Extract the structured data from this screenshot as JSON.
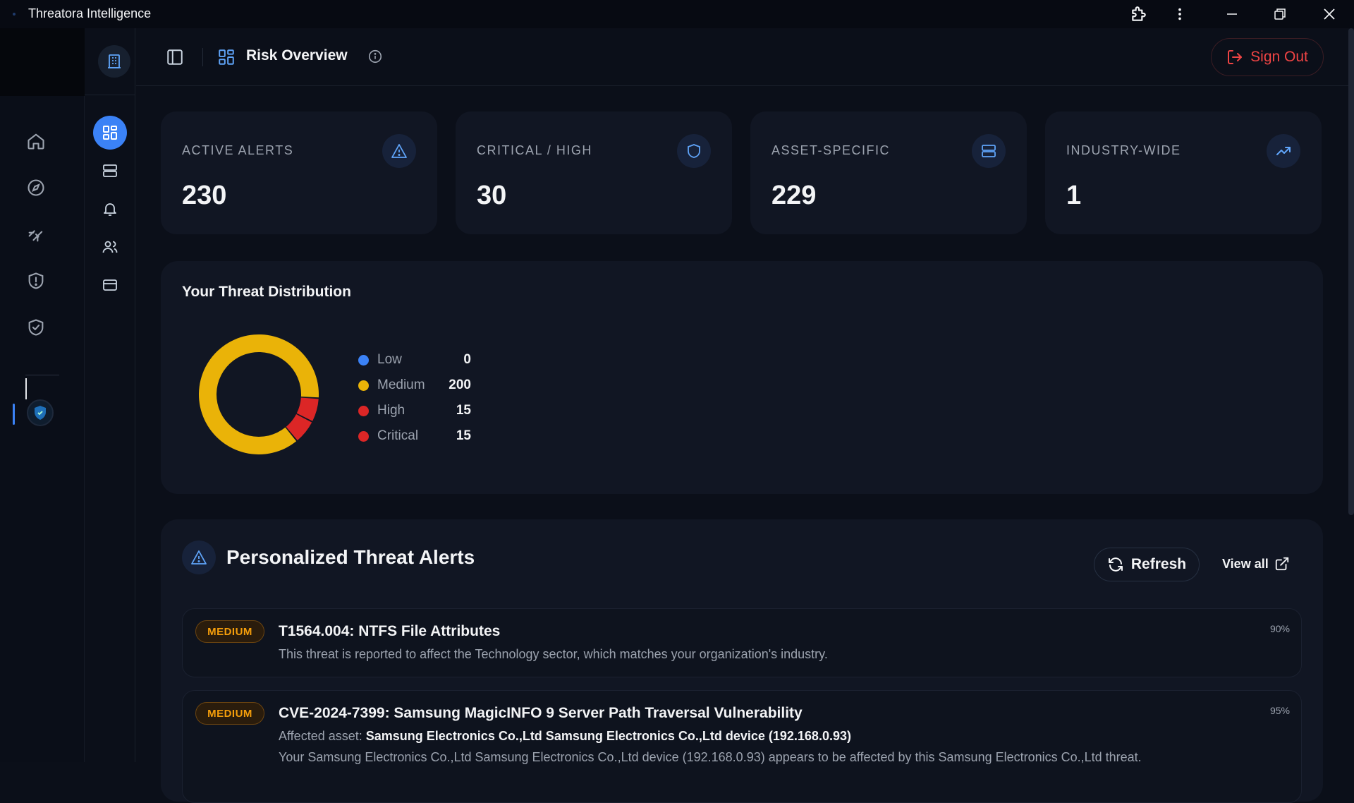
{
  "window": {
    "title": "Threatora Intelligence"
  },
  "header": {
    "title": "Risk Overview",
    "sign_out": "Sign Out"
  },
  "stats": [
    {
      "label": "ACTIVE ALERTS",
      "value": "230",
      "icon": "alert-triangle-icon"
    },
    {
      "label": "CRITICAL / HIGH",
      "value": "30",
      "icon": "shield-icon"
    },
    {
      "label": "ASSET-SPECIFIC",
      "value": "229",
      "icon": "server-icon"
    },
    {
      "label": "INDUSTRY-WIDE",
      "value": "1",
      "icon": "trending-up-icon"
    }
  ],
  "distribution": {
    "title": "Your Threat Distribution",
    "legend": [
      {
        "name": "Low",
        "value": "0",
        "color": "#3b82f6"
      },
      {
        "name": "Medium",
        "value": "200",
        "color": "#eab308"
      },
      {
        "name": "High",
        "value": "15",
        "color": "#dc2626"
      },
      {
        "name": "Critical",
        "value": "15",
        "color": "#dc2626"
      }
    ]
  },
  "alerts": {
    "title": "Personalized Threat Alerts",
    "refresh": "Refresh",
    "view_all": "View all",
    "items": [
      {
        "severity": "MEDIUM",
        "title": "T1564.004: NTFS File Attributes",
        "description": "This threat is reported to affect the Technology sector, which matches your organization's industry.",
        "confidence": "90%"
      },
      {
        "severity": "MEDIUM",
        "title": "CVE-2024-7399: Samsung MagicINFO 9 Server Path Traversal Vulnerability",
        "affected_label": "Affected asset:",
        "affected_value": "Samsung Electronics Co.,Ltd Samsung Electronics Co.,Ltd device (192.168.0.93)",
        "description": "Your Samsung Electronics Co.,Ltd Samsung Electronics Co.,Ltd device (192.168.0.93) appears to be affected by this Samsung Electronics Co.,Ltd threat.",
        "confidence": "95%"
      }
    ]
  },
  "chart_data": {
    "type": "pie",
    "categories": [
      "Low",
      "Medium",
      "High",
      "Critical"
    ],
    "values": [
      0,
      200,
      15,
      15
    ],
    "title": "Your Threat Distribution"
  }
}
